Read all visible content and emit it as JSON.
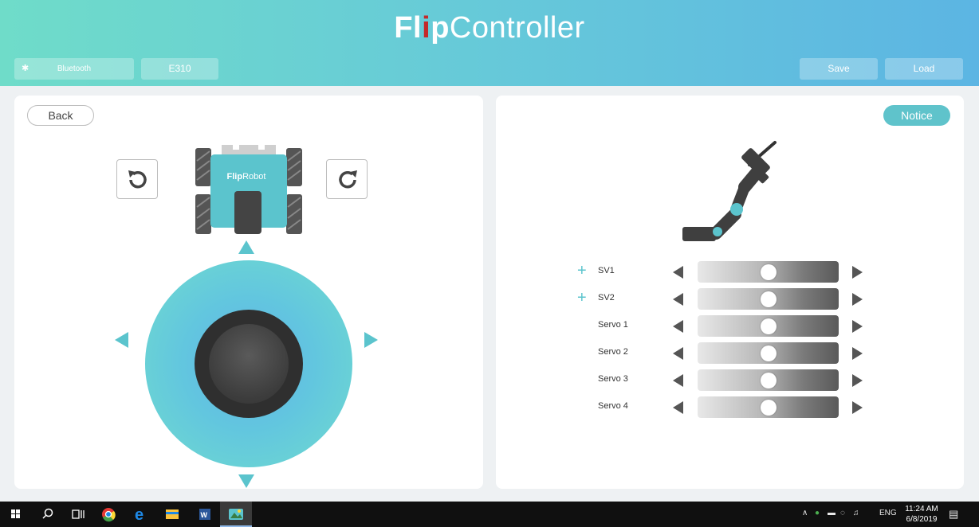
{
  "header": {
    "logo_bold": "Fl",
    "logo_dot": "i",
    "logo_bold2": "p",
    "logo_rest": "Controller",
    "bluetooth_label": "Bluetooth",
    "model_label": "E310",
    "save_label": "Save",
    "load_label": "Load"
  },
  "left_panel": {
    "back_label": "Back",
    "robot_label_bold": "Flip",
    "robot_label_rest": "Robot"
  },
  "right_panel": {
    "notice_label": "Notice",
    "servos": [
      {
        "label": "SV1",
        "has_plus": true,
        "value": 0.5
      },
      {
        "label": "SV2",
        "has_plus": true,
        "value": 0.5
      },
      {
        "label": "Servo 1",
        "has_plus": false,
        "value": 0.5
      },
      {
        "label": "Servo 2",
        "has_plus": false,
        "value": 0.5
      },
      {
        "label": "Servo 3",
        "has_plus": false,
        "value": 0.5
      },
      {
        "label": "Servo 4",
        "has_plus": false,
        "value": 0.5
      }
    ]
  },
  "taskbar": {
    "lang": "ENG",
    "time": "11:24 AM",
    "date": "6/8/2019"
  },
  "colors": {
    "accent": "#5bc4cd",
    "header_left": "#6fdcc9",
    "header_right": "#5cb5e3",
    "logo_dot": "#c32a2a"
  }
}
